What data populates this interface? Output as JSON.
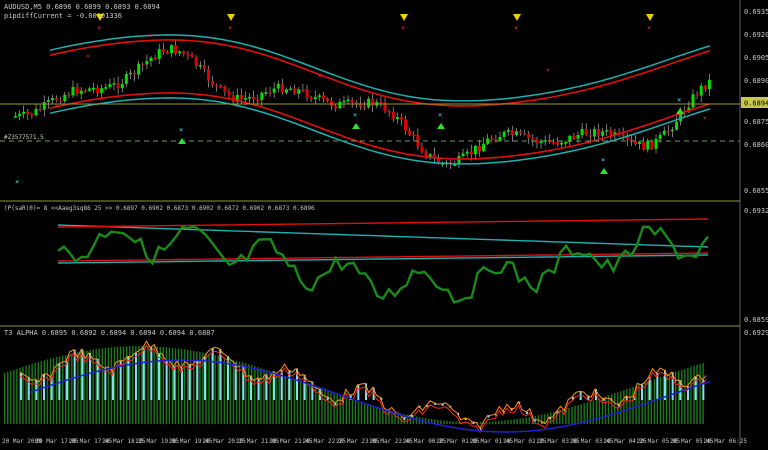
{
  "panel1": {
    "symbol_line": "AUDUSD,M5  0.6896  0.6899  0.6893  0.6894",
    "sub_line": "pipdiffCurrent = -0.00001336",
    "marker_label": "#Z3577571.5",
    "price_box": "0.6894",
    "price_scale": [
      "0.6935",
      "0.6920",
      "0.6905",
      "0.6890",
      "0.6875",
      "0.6860",
      "0.6855"
    ]
  },
  "panel2": {
    "header": "(P(saR(0)= 8 <<Aaeg3sq86 25 >>  0.6897  0.6902  0.6873  0.6902  0.6872  0.6902  0.6873  0.6896",
    "price_scale": [
      "0.6932",
      "0.6859"
    ]
  },
  "panel3": {
    "header": "T3 ALPHA  0.6895  0.6892  0.6894  0.6894  0.6894  0.6887",
    "price_scale": [
      "0.6929"
    ]
  },
  "time_axis": [
    "20 Mar 2009",
    "20 Mar 17:05",
    "20 Mar 17:45",
    "20 Mar 18:25",
    "20 Mar 19:05",
    "20 Mar 19:45",
    "20 Mar 20:25",
    "20 Mar 21:05",
    "20 Mar 21:45",
    "20 Mar 22:25",
    "20 Mar 23:05",
    "20 Mar 23:45",
    "20 Mar 00:25",
    "20 Mar 01:05",
    "20 Mar 01:45",
    "20 Mar 02:25",
    "20 Mar 03:05",
    "20 Mar 03:45",
    "20 Mar 04:25",
    "20 Mar 05:05",
    "20 Mar 05:45",
    "20 Mar 06:25"
  ],
  "colors": {
    "background": "#000000",
    "bull": "#00e000",
    "bear": "#e00000",
    "envelope_cyan": "#20b0b0",
    "envelope_red": "#e01010",
    "oscillator": "#1a8a1a",
    "histogram": "#1a7a1a",
    "histogram_hi": "#80e0f0",
    "separator": "#b0b040",
    "label": "#c8c8c8"
  }
}
